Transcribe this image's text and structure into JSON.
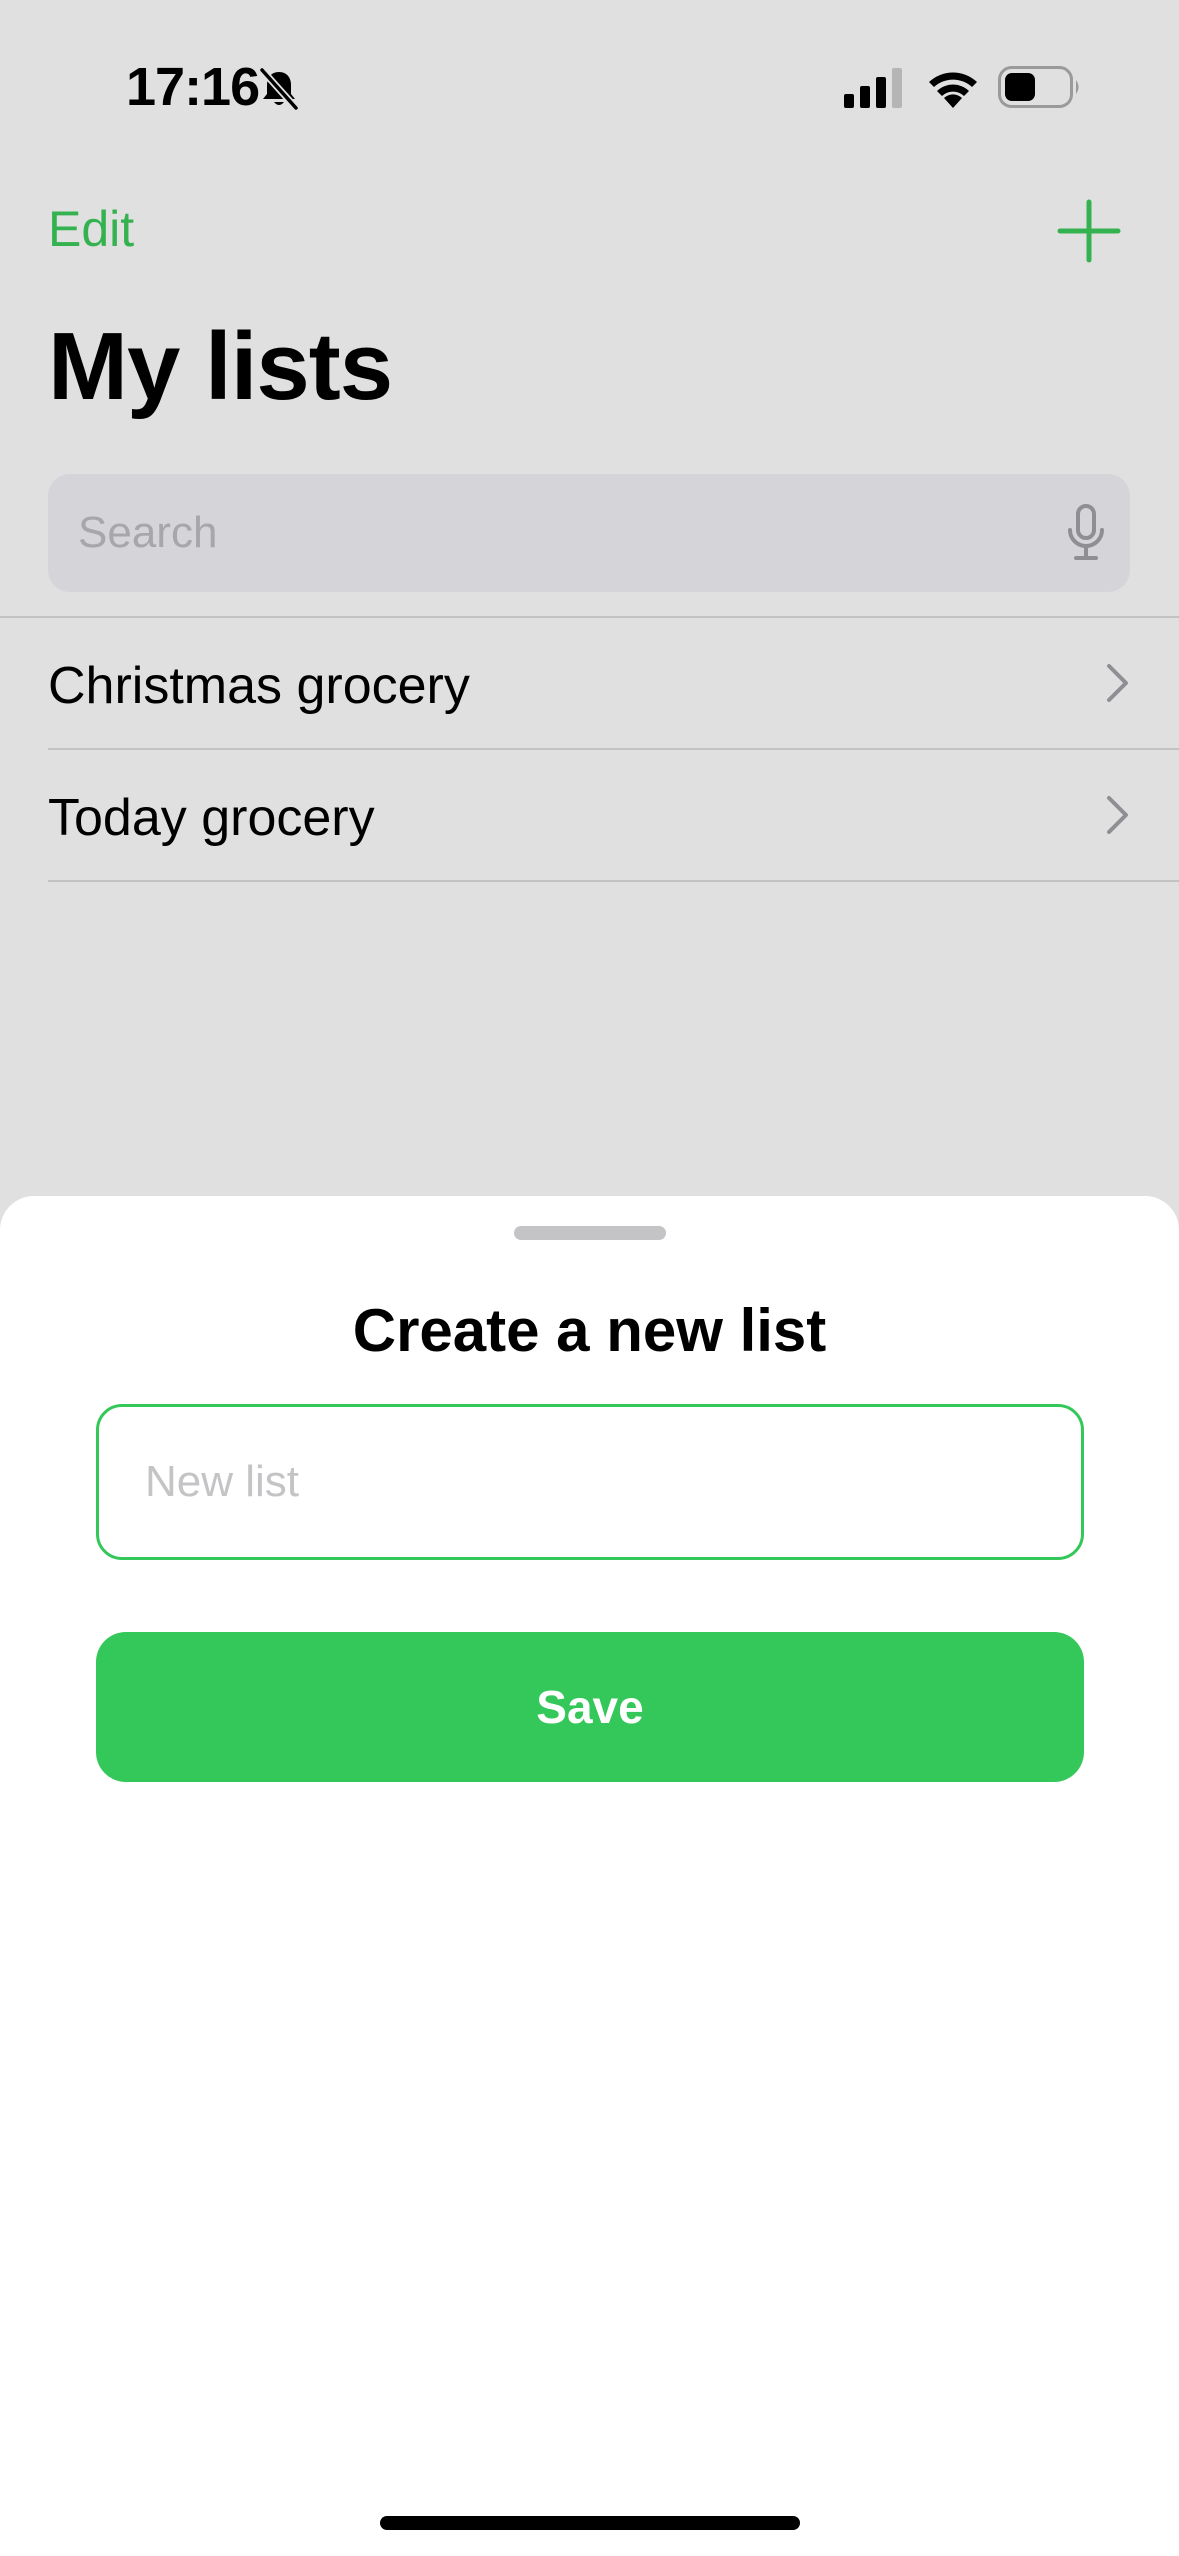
{
  "status_bar": {
    "time": "17:16",
    "icons": [
      "bell-slash-icon",
      "signal-icon",
      "wifi-icon",
      "battery-icon"
    ]
  },
  "nav": {
    "edit_label": "Edit",
    "add_icon": "plus-icon",
    "title": "My lists"
  },
  "search": {
    "placeholder": "Search",
    "icon": "mic-icon"
  },
  "lists": {
    "items": [
      {
        "label": "Christmas grocery"
      },
      {
        "label": "Today grocery"
      }
    ]
  },
  "sheet": {
    "title": "Create a new list",
    "input_placeholder": "New list",
    "input_value": "",
    "save_label": "Save"
  },
  "colors": {
    "accent": "#34c759",
    "background": "#e0e0e0",
    "sheet": "#ffffff"
  }
}
